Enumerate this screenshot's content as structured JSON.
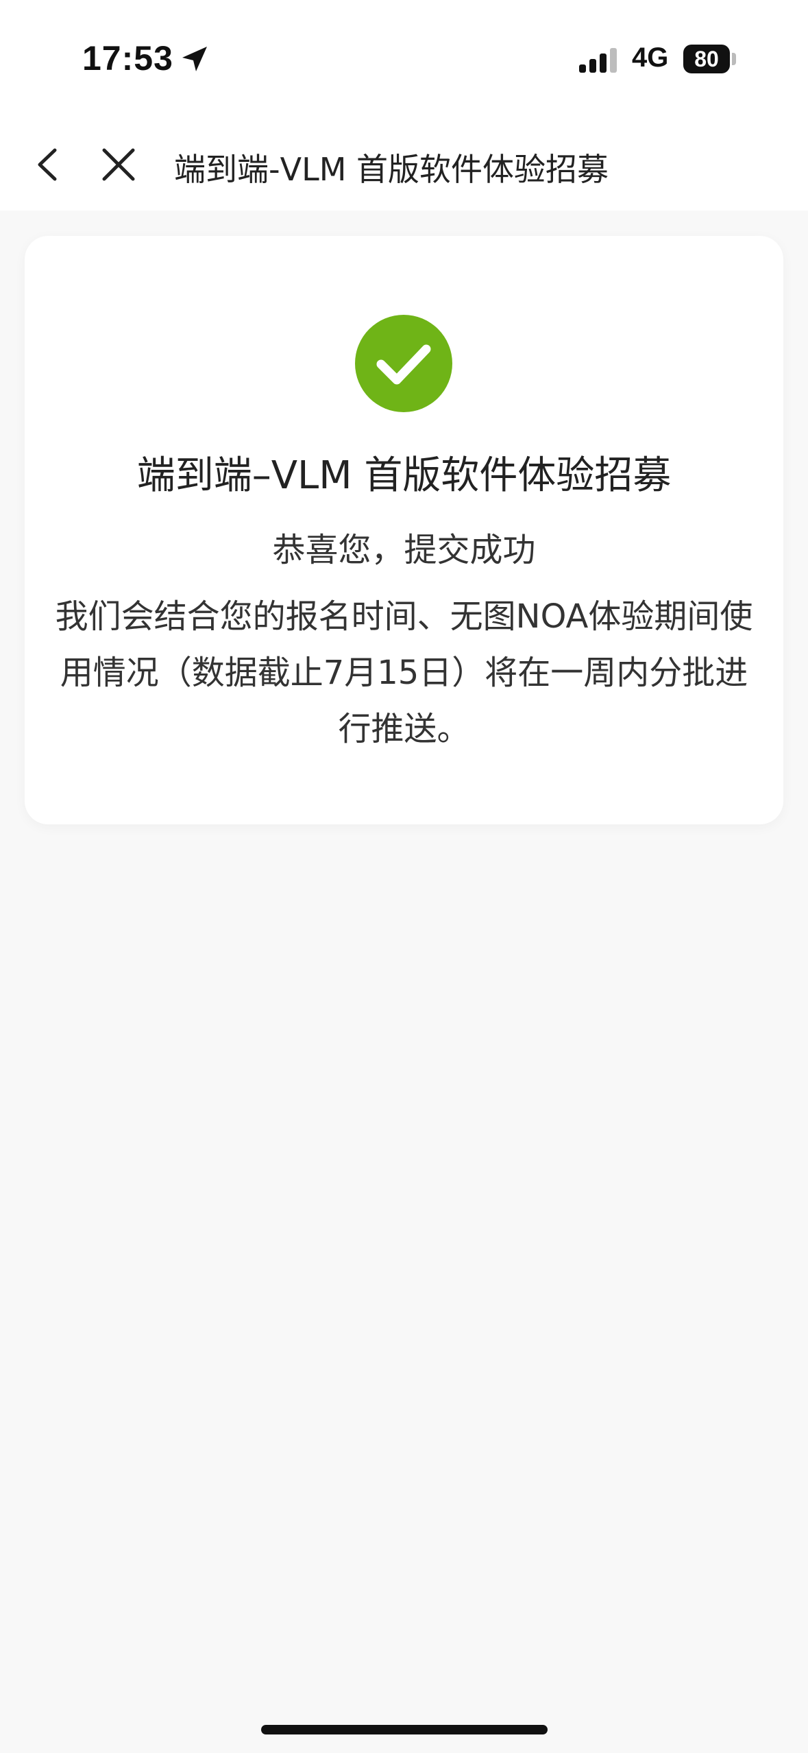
{
  "status_bar": {
    "time": "17:53",
    "network": "4G",
    "battery": "80",
    "location_icon": "location-arrow-icon",
    "signal_icon": "cellular-signal-icon"
  },
  "nav": {
    "title": "端到端-VLM 首版软件体验招募",
    "back_icon": "chevron-left-icon",
    "close_icon": "close-icon"
  },
  "card": {
    "icon": "check-circle-icon",
    "title": "端到端–VLM 首版软件体验招募",
    "subtitle": "恭喜您，提交成功",
    "body": "我们会结合您的报名时间、无图NOA体验期间使用情况（数据截止7月15日）将在一周内分批进行推送。"
  },
  "colors": {
    "success_green": "#6fb417",
    "page_background": "#f8f8f8",
    "card_background": "#ffffff"
  }
}
